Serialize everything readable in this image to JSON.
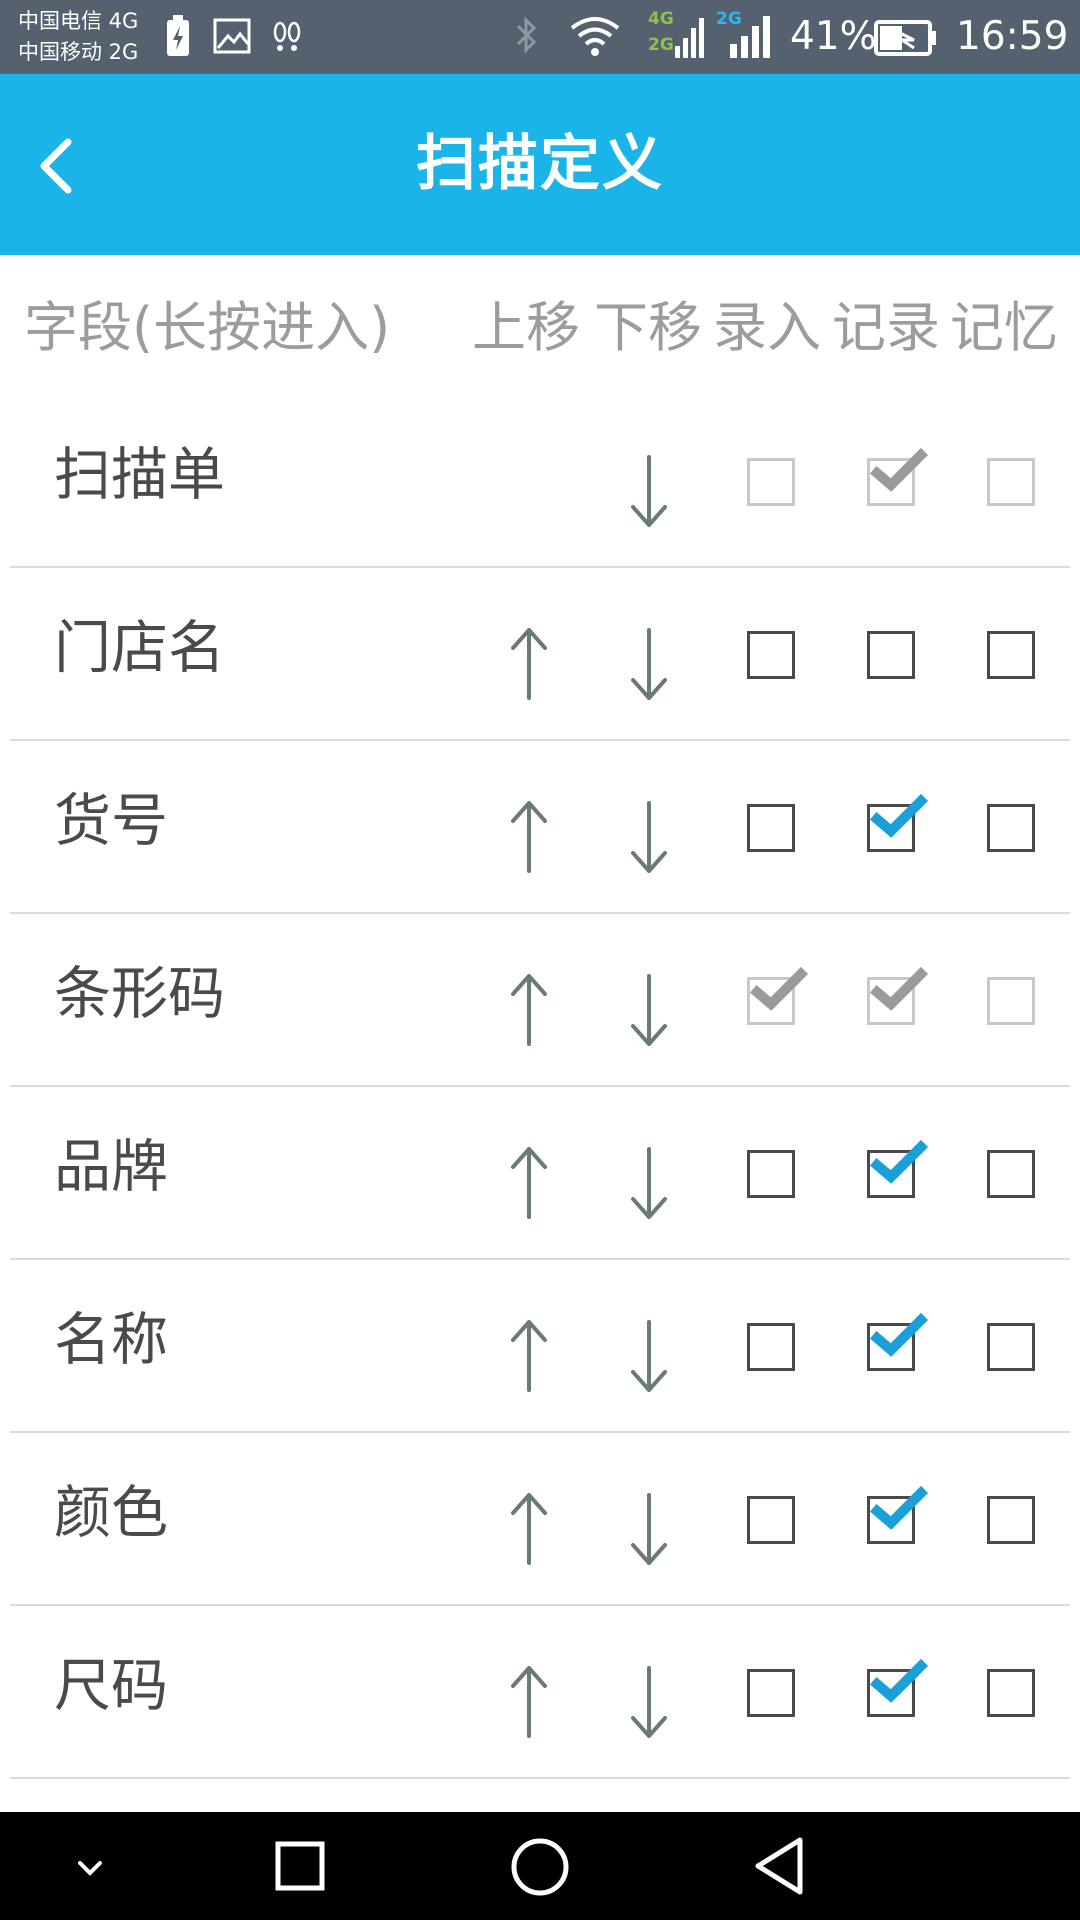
{
  "status_bar": {
    "carrier_1": "中国电信 4G",
    "carrier_2": "中国移动 2G",
    "net_4g": "4G",
    "net_2g_a": "2G",
    "net_2g_b": "2G",
    "battery_percent": "41%",
    "time": "16:59",
    "colors": {
      "background": "#56616f",
      "net_4g": "#8bc34a",
      "net_2g": "#29b6f6"
    }
  },
  "app_bar": {
    "title": "扫描定义",
    "back_icon": "chevron-left-icon",
    "background": "#1bb4e8"
  },
  "columns": {
    "field": "字段(长按进入)",
    "move_up": "上移",
    "move_down": "下移",
    "input": "录入",
    "record": "记录",
    "remember": "记忆"
  },
  "rows": [
    {
      "label": "扫描单",
      "can_move_up": false,
      "can_move_down": true,
      "input": false,
      "record": true,
      "remember": false,
      "input_enabled": false,
      "record_enabled": false,
      "remember_enabled": false
    },
    {
      "label": "门店名",
      "can_move_up": true,
      "can_move_down": true,
      "input": false,
      "record": false,
      "remember": false,
      "input_enabled": true,
      "record_enabled": true,
      "remember_enabled": true
    },
    {
      "label": "货号",
      "can_move_up": true,
      "can_move_down": true,
      "input": false,
      "record": true,
      "remember": false,
      "input_enabled": true,
      "record_enabled": true,
      "remember_enabled": true
    },
    {
      "label": "条形码",
      "can_move_up": true,
      "can_move_down": true,
      "input": true,
      "record": true,
      "remember": false,
      "input_enabled": false,
      "record_enabled": false,
      "remember_enabled": false
    },
    {
      "label": "品牌",
      "can_move_up": true,
      "can_move_down": true,
      "input": false,
      "record": true,
      "remember": false,
      "input_enabled": true,
      "record_enabled": true,
      "remember_enabled": true
    },
    {
      "label": "名称",
      "can_move_up": true,
      "can_move_down": true,
      "input": false,
      "record": true,
      "remember": false,
      "input_enabled": true,
      "record_enabled": true,
      "remember_enabled": true
    },
    {
      "label": "颜色",
      "can_move_up": true,
      "can_move_down": true,
      "input": false,
      "record": true,
      "remember": false,
      "input_enabled": true,
      "record_enabled": true,
      "remember_enabled": true
    },
    {
      "label": "尺码",
      "can_move_up": true,
      "can_move_down": true,
      "input": false,
      "record": true,
      "remember": false,
      "input_enabled": true,
      "record_enabled": true,
      "remember_enabled": true
    }
  ],
  "nav_bar": {
    "icons": [
      "chevron-down-icon",
      "recents-square-icon",
      "home-circle-icon",
      "back-triangle-icon"
    ]
  },
  "theme": {
    "checkmark_active": "#1a9fd8",
    "checkmark_disabled": "#9a9a9a",
    "arrow_color": "#6a7a78"
  }
}
